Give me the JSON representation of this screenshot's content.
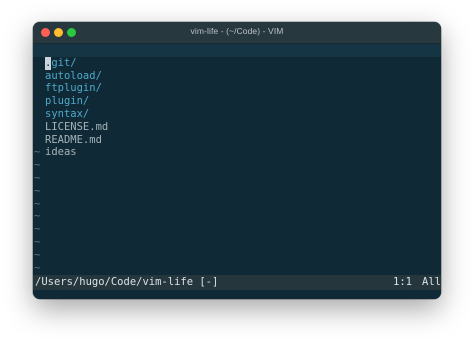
{
  "window": {
    "title": "vim-life - (~/Code) - VIM"
  },
  "colors": {
    "close": "#fe5f57",
    "minimize": "#febc2e",
    "maximize": "#28c840",
    "background": "#0f2a36",
    "directory": "#4fa8c9",
    "file": "#a4b3b9",
    "tilde": "#5d7580"
  },
  "editor": {
    "entries": [
      {
        "cursor_char": ".",
        "text": "git/",
        "kind": "directory"
      },
      {
        "text": "autoload/",
        "kind": "directory"
      },
      {
        "text": "ftplugin/",
        "kind": "directory"
      },
      {
        "text": "plugin/",
        "kind": "directory"
      },
      {
        "text": "syntax/",
        "kind": "directory"
      },
      {
        "text": "LICENSE.md",
        "kind": "file"
      },
      {
        "text": "README.md",
        "kind": "file"
      },
      {
        "text": "ideas",
        "kind": "file"
      }
    ],
    "tilde": "~",
    "empty_line_count": 10
  },
  "status": {
    "path": "/Users/hugo/Code/vim-life [-]",
    "position": "1:1",
    "scroll": "All"
  }
}
